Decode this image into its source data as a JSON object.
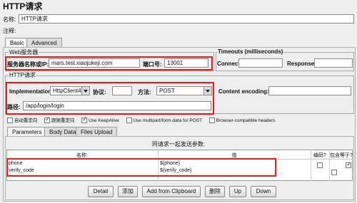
{
  "title": "HTTP请求",
  "name_label": "名称:",
  "name_value": "HTTP请求",
  "comment_label": "注释:",
  "tabs": [
    "Basic",
    "Advanced"
  ],
  "web_server": {
    "legend": "Web服务器",
    "server_label": "服务器名称或IP:",
    "server_value": "mars.test.xiaojukeji.com",
    "port_label": "端口号:",
    "port_value": "13001"
  },
  "timeouts": {
    "legend": "Timeouts (milliseconds)",
    "connect_label": "Connect:",
    "response_label": "Response:"
  },
  "http_request": {
    "legend": "HTTP请求",
    "implementation_label": "Implementation:",
    "implementation_value": "HttpClient4",
    "protocol_label": "协议:",
    "protocol_value": "",
    "method_label": "方法:",
    "method_value": "POST",
    "encoding_label": "Content encoding:",
    "path_label": "路径:",
    "path_value": "/app/login/login"
  },
  "options": [
    {
      "label": "自动重定向",
      "checked": false
    },
    {
      "label": "跟随重定向",
      "checked": true
    },
    {
      "label": "Use KeepAlive",
      "checked": true
    },
    {
      "label": "Use multipart/form-data for POST",
      "checked": false
    },
    {
      "label": "Browser-compatible headers",
      "checked": false
    }
  ],
  "sub_tabs": [
    "Parameters",
    "Body Data",
    "Files Upload"
  ],
  "params": {
    "caption": "同请求一起发送参数:",
    "headers": {
      "name": "名称:",
      "value": "值",
      "encode": "编码?",
      "include": "包含等于?"
    },
    "rows": [
      {
        "name": "phone",
        "value": "${phone}",
        "encode": false,
        "include": true
      },
      {
        "name": "verify_code",
        "value": "${verify_code}",
        "encode": false,
        "include": true
      }
    ]
  },
  "buttons": [
    "Detail",
    "添加",
    "Add from Clipboard",
    "删除",
    "Up",
    "Down"
  ]
}
